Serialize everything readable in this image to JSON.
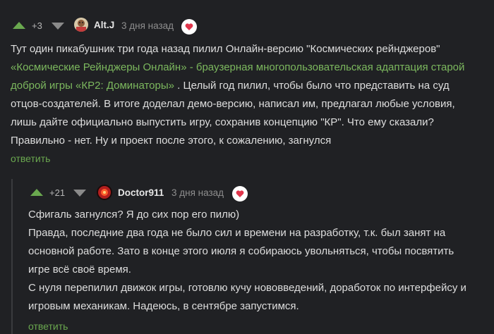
{
  "comment1": {
    "rating": "+3",
    "author": "Alt.J",
    "date": "3 дня назад",
    "line1": "Тут один пикабушник три года назад пилил Онлайн-версию \"Космических рейнджеров\"",
    "line2_link": "«Космические Рейнджеры Онлайн» - браузерная многопользовательская адаптация старой",
    "line3_link": "доброй игры «КР2: Доминаторы»",
    "line3_rest": " . Целый год пилил, чтобы было что представить на суд",
    "line4": "отцов-создателей. В итоге доделал демо-версию, написал им, предлагал любые условия,",
    "line5": "лишь дайте официально выпустить игру, сохранив концепцию \"КР\". Что ему сказали?",
    "line6": "Правильно - нет. Ну и проект после этого, к сожалению, загнулся",
    "reply": "ответить"
  },
  "comment2": {
    "rating": "+21",
    "author": "Doctor911",
    "date": "3 дня назад",
    "line1": "Сфигаль загнулся? Я до сих пор его пилю)",
    "line2": "Правда, последние два года не было сил и времени на разработку, т.к. был занят на",
    "line3": "основной работе. Зато в конце этого июля я собираюсь увольняться, чтобы посвятить",
    "line4": "игре всё своё время.",
    "line5": "С нуля перепилил движок игры, готовлю кучу нововведений, доработок по интерфейсу и",
    "line6": "игровым механикам. Надеюсь, в сентябре запустимся.",
    "reply": "ответить"
  },
  "colors": {
    "background": "#202124",
    "accent": "#6aa84f",
    "link": "#7cb85e",
    "heart": "#e0354b"
  },
  "icons": [
    "vote-up-icon",
    "vote-down-icon",
    "heart-icon",
    "avatar-image"
  ]
}
